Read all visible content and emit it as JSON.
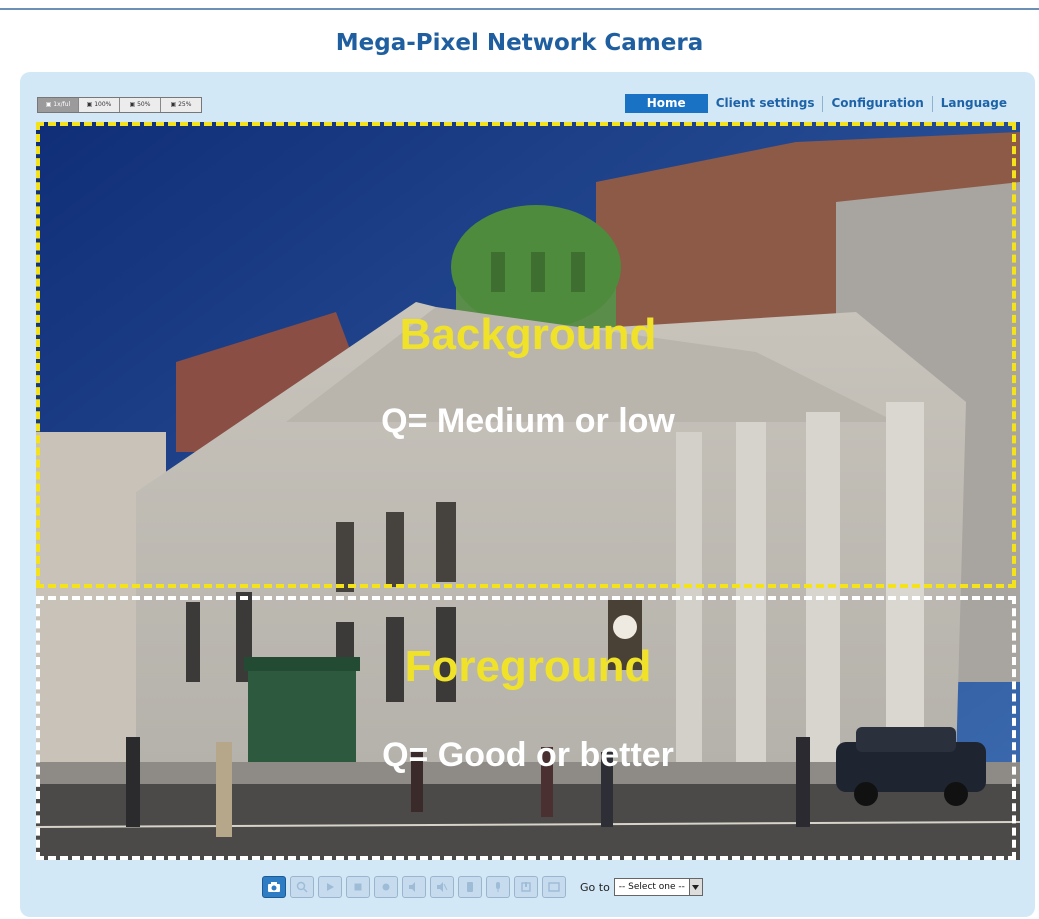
{
  "header": {
    "title": "Mega-Pixel Network Camera"
  },
  "zoom": {
    "options": [
      {
        "label": "▣ 1x/ful",
        "active": true
      },
      {
        "label": "▣ 100%",
        "active": false
      },
      {
        "label": "▣ 50%",
        "active": false
      },
      {
        "label": "▣ 25%",
        "active": false
      }
    ]
  },
  "nav": {
    "home": "Home",
    "client_settings": "Client settings",
    "configuration": "Configuration",
    "language": "Language"
  },
  "view": {
    "background_label": "Background",
    "background_quality": "Q= Medium or low",
    "foreground_label": "Foreground",
    "foreground_quality": "Q= Good or better",
    "colors": {
      "background_border": "#f4e21a",
      "foreground_border": "#ffffff"
    }
  },
  "controls": {
    "buttons": [
      {
        "icon": "snapshot-icon"
      },
      {
        "icon": "digital-zoom-icon"
      },
      {
        "icon": "play-icon"
      },
      {
        "icon": "stop-icon"
      },
      {
        "icon": "record-icon"
      },
      {
        "icon": "volume-icon"
      },
      {
        "icon": "mute-icon"
      },
      {
        "icon": "talk-icon"
      },
      {
        "icon": "microphone-icon"
      },
      {
        "icon": "manual-trigger-icon"
      },
      {
        "icon": "fullscreen-icon"
      }
    ],
    "goto_label": "Go to",
    "goto_value": "-- Select one --"
  }
}
